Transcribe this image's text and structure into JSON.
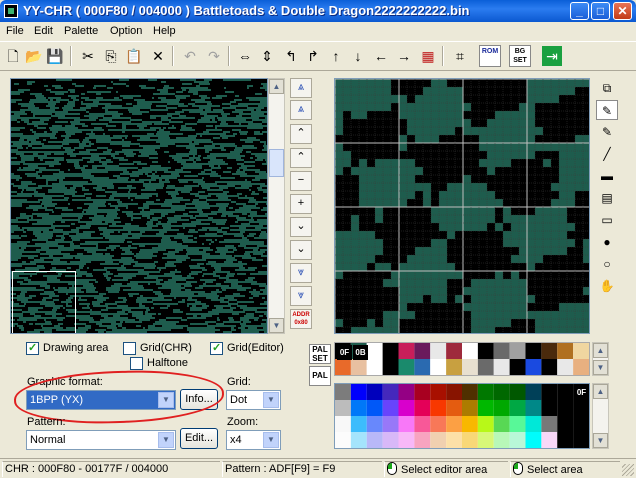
{
  "window": {
    "title": "YY-CHR ( 000F80 / 004000 ) Battletoads & Double Dragon2222222222.bin",
    "minimize": "_",
    "maximize": "□",
    "close": "✕"
  },
  "menu": [
    "File",
    "Edit",
    "Palette",
    "Option",
    "Help"
  ],
  "toolbar": [
    {
      "name": "new-file-icon",
      "glyph": "🗋"
    },
    {
      "name": "open-folder-icon",
      "glyph": "📂"
    },
    {
      "name": "save-disk-icon",
      "glyph": "💾"
    },
    {
      "name": "cut-icon",
      "glyph": "✂"
    },
    {
      "name": "copy-icon",
      "glyph": "⎘"
    },
    {
      "name": "paste-icon",
      "glyph": "📋"
    },
    {
      "name": "delete-icon",
      "glyph": "✕"
    },
    {
      "name": "undo-icon",
      "glyph": "↶"
    },
    {
      "name": "redo-icon",
      "glyph": "↷"
    },
    {
      "name": "flip-horizontal-icon",
      "glyph": "⇔"
    },
    {
      "name": "flip-vertical-icon",
      "glyph": "⇕"
    },
    {
      "name": "rotate-left-icon",
      "glyph": "↰"
    },
    {
      "name": "rotate-right-icon",
      "glyph": "↱"
    },
    {
      "name": "shift-up-icon",
      "glyph": "↑"
    },
    {
      "name": "shift-down-icon",
      "glyph": "↓"
    },
    {
      "name": "shift-left-icon",
      "glyph": "←"
    },
    {
      "name": "shift-right-icon",
      "glyph": "→"
    },
    {
      "name": "palette-tool-icon",
      "glyph": "▦"
    },
    {
      "name": "pattern-tool-icon",
      "glyph": "⌗"
    },
    {
      "name": "rom-tool-icon",
      "label": "ROM"
    },
    {
      "name": "bg-set-icon",
      "label": "BG SET"
    },
    {
      "name": "exit-icon",
      "glyph": "⇥"
    }
  ],
  "nav": {
    "addr_label": "ADDR 0x80",
    "buttons": [
      "⩓",
      "⩓",
      "⌃",
      "⌃",
      "−",
      "+",
      "⌄",
      "⌄",
      "⩔",
      "⩔"
    ]
  },
  "tools": [
    "⧉",
    "✎",
    "✎",
    "╱",
    "▬",
    "▤",
    "▭",
    "●",
    "○",
    "✋"
  ],
  "options": {
    "drawing_area": "Drawing area",
    "grid_chr": "Grid(CHR)",
    "grid_editor": "Grid(Editor)",
    "halftone": "Halftone",
    "drawing_area_checked": true,
    "grid_chr_checked": false,
    "grid_editor_checked": true,
    "halftone_checked": false
  },
  "graphic_format": {
    "label": "Graphic format:",
    "value": "1BPP (YX)",
    "info_button": "Info..."
  },
  "pattern": {
    "label": "Pattern:",
    "value": "Normal",
    "edit_button": "Edit..."
  },
  "grid": {
    "label": "Grid:",
    "value": "Dot"
  },
  "zoom": {
    "label": "Zoom:",
    "value": "x4"
  },
  "palette": {
    "pal_set_button": "PAL SET",
    "pal_button": "PAL",
    "tag_0f": "0F",
    "tag_0b": "0B",
    "full_tag": "0F",
    "set_colors": [
      "#000000",
      "#1e5c4d",
      "#ffffff",
      "#000000",
      "#c81e5a",
      "#6a1a5c",
      "#e8e8e8",
      "#9e2a3c",
      "#ffffff",
      "#000000",
      "#6a6a6a",
      "#a0a0a0",
      "#000000",
      "#4a2a0c",
      "#b07020",
      "#f0d6a0"
    ],
    "set_colors_row2": [
      "#e86a2a",
      "#e8c0a0",
      "#ffffff",
      "#000000",
      "#1a8a6c",
      "#2a6ab0",
      "#ffffff",
      "#c8a040",
      "#e8e0d0",
      "#6a6a6a",
      "#e8e8e8",
      "#000000",
      "#1a4ae0",
      "#000000",
      "#e8e8e8",
      "#e8b080"
    ],
    "nes_rows": [
      [
        "#7c7c7c",
        "#0000fc",
        "#0000bc",
        "#4428bc",
        "#940084",
        "#a80020",
        "#a81000",
        "#881400",
        "#503000",
        "#007800",
        "#006800",
        "#005800",
        "#004058",
        "#000000",
        "#000000",
        "#000000"
      ],
      [
        "#bcbcbc",
        "#0078f8",
        "#0058f8",
        "#6844fc",
        "#d800cc",
        "#e40058",
        "#f83800",
        "#e45c10",
        "#ac7c00",
        "#00b800",
        "#00a800",
        "#00a844",
        "#008888",
        "#000000",
        "#000000",
        "#000000"
      ],
      [
        "#f8f8f8",
        "#3cbcfc",
        "#6888fc",
        "#9878f8",
        "#f878f8",
        "#f85898",
        "#f87858",
        "#fca044",
        "#f8b800",
        "#b8f818",
        "#58d854",
        "#58f898",
        "#00e8d8",
        "#787878",
        "#000000",
        "#000000"
      ],
      [
        "#fcfcfc",
        "#a4e4fc",
        "#b8b8f8",
        "#d8b8f8",
        "#f8b8f8",
        "#f8a4c0",
        "#f0d0b0",
        "#fce0a8",
        "#f8d878",
        "#d8f878",
        "#b8f8b8",
        "#b8f8d8",
        "#00fcfc",
        "#f8d8f8",
        "#000000",
        "#000000"
      ]
    ]
  },
  "colors": {
    "tile_green": "#1e5c4d",
    "tile_black": "#000000"
  },
  "status": {
    "chr": "CHR : 000F80 - 00177F / 004000",
    "pattern": "Pattern : ADF[F9] = F9",
    "select_editor": "Select editor area",
    "select_area": "Select area"
  }
}
